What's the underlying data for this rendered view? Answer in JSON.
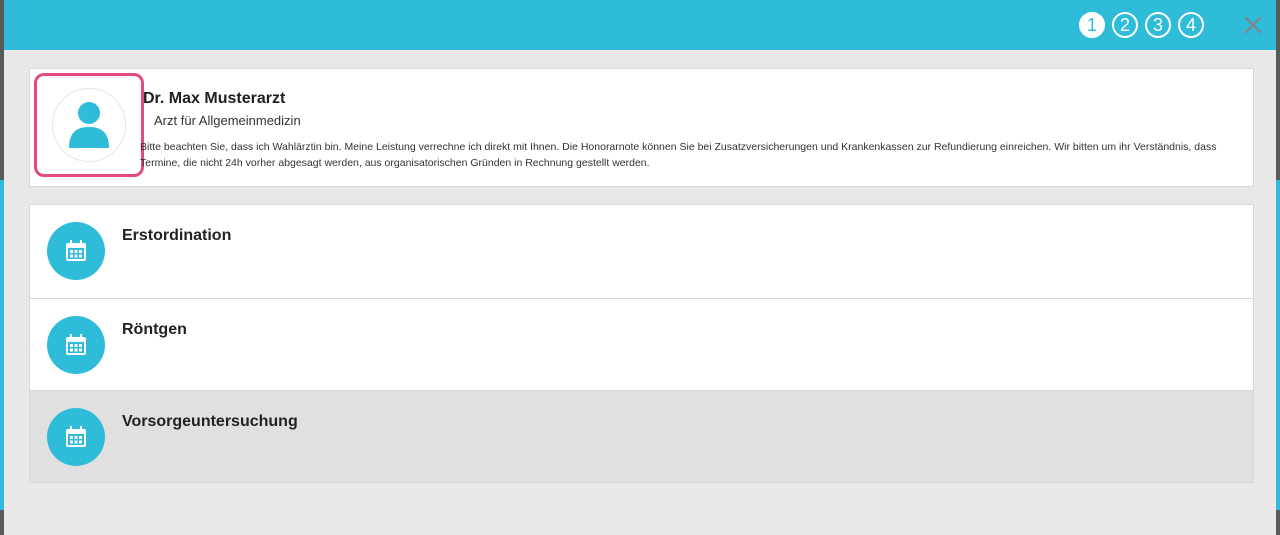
{
  "header": {
    "steps": [
      "1",
      "2",
      "3",
      "4"
    ],
    "active_step": "1",
    "close_icon": "close-icon"
  },
  "doctor": {
    "name": "Dr. Max Musterarzt",
    "specialty": "Arzt für Allgemeinmedizin",
    "note": "Bitte beachten Sie, dass ich Wahlärztin bin. Meine Leistung verrechne ich direkt mit Ihnen. Die Honorarnote können Sie bei Zusatzversicherungen und Krankenkassen zur Refundierung einreichen. Wir bitten um ihr Verständnis, dass Termine, die nicht 24h vorher abgesagt werden, aus organisatorischen Gründen in Rechnung gestellt werden.",
    "avatar_icon": "user-icon"
  },
  "services": [
    {
      "label": "Erstordination",
      "icon": "calendar-icon",
      "selected": false
    },
    {
      "label": "Röntgen",
      "icon": "calendar-icon",
      "selected": false
    },
    {
      "label": "Vorsorgeuntersuchung",
      "icon": "calendar-icon",
      "selected": true
    }
  ],
  "colors": {
    "accent": "#2ebcd9",
    "highlight_border": "#e44a7e",
    "selected_row": "#e0e0e0"
  }
}
